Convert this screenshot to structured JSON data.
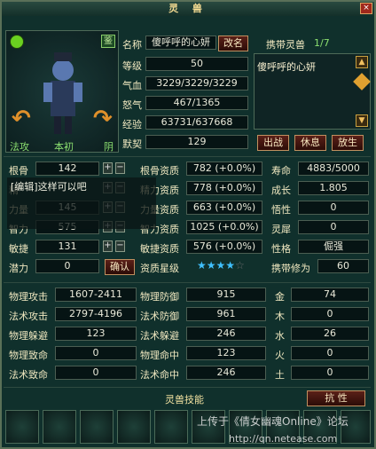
{
  "window": {
    "title": "灵 兽",
    "close": "×"
  },
  "portrait": {
    "badge": "鉴",
    "side_left": "法攻",
    "side_mid": "本初",
    "side_right": "阴"
  },
  "info": {
    "name_label": "名称",
    "name_value": "傻呼呼的心妍",
    "rename": "改名",
    "level_label": "等级",
    "level_value": "50",
    "hp_label": "气血",
    "hp_value": "3229/3229/3229",
    "anger_label": "怒气",
    "anger_value": "467/1365",
    "exp_label": "经验",
    "exp_value": "63731/637668",
    "bond_label": "默契",
    "bond_value": "129"
  },
  "carry": {
    "title": "携带灵兽",
    "count": "1/7",
    "items": [
      "傻呼呼的心妍"
    ]
  },
  "actions": {
    "battle": "出战",
    "rest": "休息",
    "release": "放生"
  },
  "stats_left": [
    {
      "label": "根骨",
      "value": "142"
    },
    {
      "label": "精",
      "value": ""
    },
    {
      "label": "力量",
      "value": "145"
    },
    {
      "label": "智力",
      "value": "575"
    },
    {
      "label": "敏捷",
      "value": "131"
    },
    {
      "label": "潜力",
      "value": "0"
    }
  ],
  "confirm": "确认",
  "aptitudes": [
    {
      "label": "根骨资质",
      "value": "782 (+0.0%)"
    },
    {
      "label": "精力资质",
      "value": "778 (+0.0%)"
    },
    {
      "label": "力量资质",
      "value": "663 (+0.0%)"
    },
    {
      "label": "智力资质",
      "value": "1025 (+0.0%)"
    },
    {
      "label": "敏捷资质",
      "value": "576 (+0.0%)"
    },
    {
      "label": "资质星级",
      "value": "4/5"
    }
  ],
  "traits": [
    {
      "label": "寿命",
      "value": "4883/5000"
    },
    {
      "label": "成长",
      "value": "1.805"
    },
    {
      "label": "悟性",
      "value": "0"
    },
    {
      "label": "灵犀",
      "value": "0"
    },
    {
      "label": "性格",
      "value": "倔强"
    },
    {
      "label": "携带修为",
      "value": "60"
    }
  ],
  "combat": [
    {
      "l1": "物理攻击",
      "v1": "1607-2411",
      "l2": "物理防御",
      "v2": "915",
      "l3": "金",
      "v3": "74"
    },
    {
      "l1": "法术攻击",
      "v1": "2797-4196",
      "l2": "法术防御",
      "v2": "961",
      "l3": "木",
      "v3": "0"
    },
    {
      "l1": "物理躲避",
      "v1": "123",
      "l2": "法术躲避",
      "v2": "246",
      "l3": "水",
      "v3": "26"
    },
    {
      "l1": "物理致命",
      "v1": "0",
      "l2": "物理命中",
      "v2": "123",
      "l3": "火",
      "v3": "0"
    },
    {
      "l1": "法术致命",
      "v1": "0",
      "l2": "法术命中",
      "v2": "246",
      "l3": "土",
      "v3": "0"
    }
  ],
  "skills": {
    "title": "灵兽技能",
    "resist": "抗 性"
  },
  "tooltip": "[编辑]这样可以吧",
  "watermark": {
    "line1": "上传于《倩女幽魂Online》论坛",
    "line2": "http://qn.netease.com"
  },
  "colors": {
    "border": "#5a7058",
    "title": "#f0d890",
    "star": "#40c0ff",
    "button": "#5a2018"
  }
}
